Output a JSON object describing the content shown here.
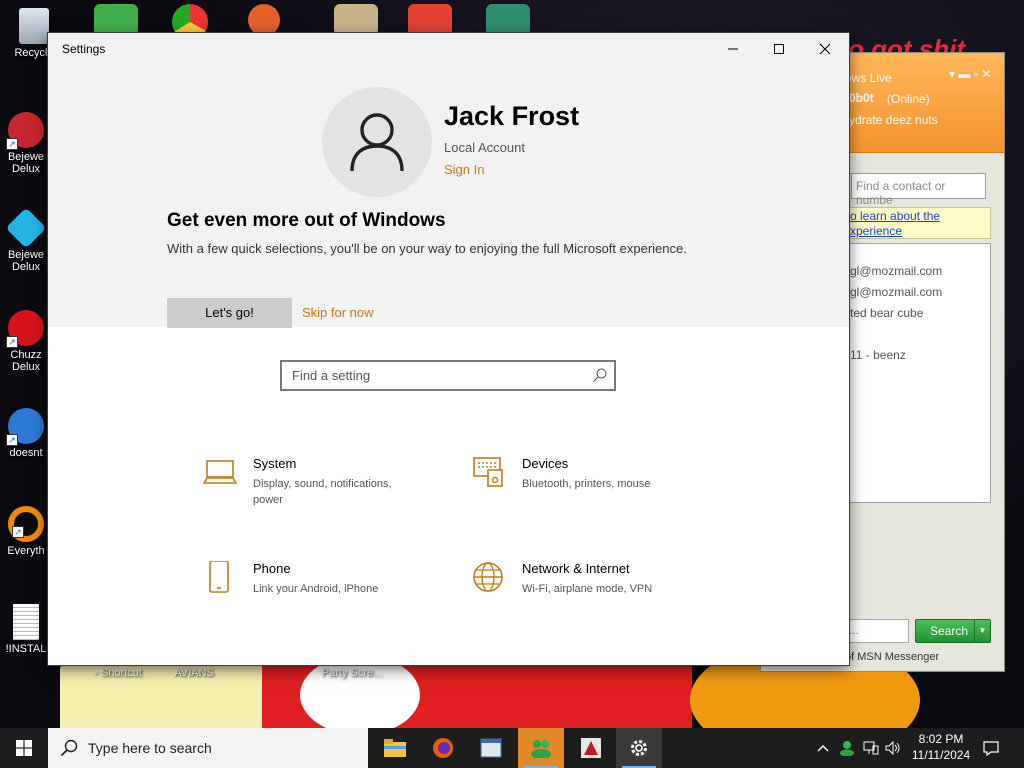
{
  "desktop": {
    "icons": [
      {
        "label": "Recycle"
      },
      {
        "label": "Bejewe Delux"
      },
      {
        "label": "Bejewe Delux"
      },
      {
        "label": "Chuzz Delux"
      },
      {
        "label": "doesnt"
      },
      {
        "label": "Everyth"
      },
      {
        "label": "!INSTAL"
      }
    ],
    "bottom_labels": [
      "- Shortcut",
      "AVIANS",
      "Party Scre..."
    ],
    "overlay_text": "o got shit"
  },
  "msn": {
    "title": "ows Live",
    "user": "0b0t",
    "status": "(Online)",
    "personal_message": "ydrate deez nuts",
    "search_placeholder": "Find a contact or numbe",
    "banner_line1": "o learn about the",
    "banner_line2": "xperience",
    "contacts": [
      "gl@mozmail.com",
      "gl@mozmail.com",
      "ted bear cube",
      "11 - beenz"
    ],
    "input_value": "...",
    "search_button": "Search",
    "footer": "of MSN Messenger"
  },
  "settings": {
    "window_title": "Settings",
    "user_name": "Jack Frost",
    "account_type": "Local Account",
    "sign_in": "Sign In",
    "promo_title": "Get even more out of Windows",
    "promo_text": "With a few quick selections, you'll be on your way to enjoying the full Microsoft experience.",
    "lets_go": "Let's go!",
    "skip": "Skip for now",
    "search_placeholder": "Find a setting",
    "categories": [
      {
        "name": "System",
        "desc": "Display, sound, notifications, power",
        "icon": "laptop-icon"
      },
      {
        "name": "Devices",
        "desc": "Bluetooth, printers, mouse",
        "icon": "devices-icon"
      },
      {
        "name": "Phone",
        "desc": "Link your Android, iPhone",
        "icon": "phone-icon"
      },
      {
        "name": "Network & Internet",
        "desc": "Wi-Fi, airplane mode, VPN",
        "icon": "globe-icon"
      }
    ]
  },
  "taskbar": {
    "search_placeholder": "Type here to search",
    "time": "8:02 PM",
    "date": "11/11/2024"
  },
  "colors": {
    "accent": "#c07b1a",
    "settings_bg": "#f2f2f2",
    "taskbar": "#1d1d1d",
    "msn_orange": "#f6932d"
  }
}
